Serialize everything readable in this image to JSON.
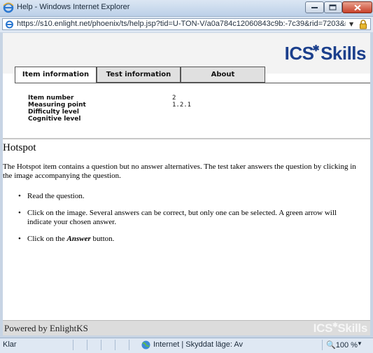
{
  "window": {
    "title": "Help - Windows Internet Explorer"
  },
  "address": {
    "url": "https://s10.enlight.net/phoenix/ts/help.jsp?tid=U-TON-V/a0a784c12060843c9b:-7c39&rid=7203&re"
  },
  "header": {
    "logo_text": "ICS",
    "logo_text2": "Skills"
  },
  "tabs": [
    {
      "label": "Item information"
    },
    {
      "label": "Test information"
    },
    {
      "label": "About"
    }
  ],
  "item_info": {
    "rows": [
      {
        "label": "Item number",
        "value": "2"
      },
      {
        "label": "Measuring point",
        "value": "1.2.1"
      },
      {
        "label": "Difficulty level",
        "value": ""
      },
      {
        "label": "Cognitive level",
        "value": ""
      }
    ]
  },
  "help": {
    "heading": "Hotspot",
    "intro": "The Hotspot item contains a question but no answer alternatives. The test taker answers the question by clicking in the image accompanying the question.",
    "bullets": [
      "Read the question.",
      "Click on the image. Several answers can be correct, but only one can be selected. A green arrow will indicate your chosen answer.",
      "Click on the"
    ],
    "bullet3_emph": "Answer",
    "bullet3_tail": "button."
  },
  "footer": {
    "powered_by": "Powered by EnlightKS",
    "logo_text": "ICS",
    "logo_text2": "Skills"
  },
  "statusbar": {
    "status": "Klar",
    "zone": "Internet | Skyddat läge: Av",
    "zoom": "100 %"
  }
}
